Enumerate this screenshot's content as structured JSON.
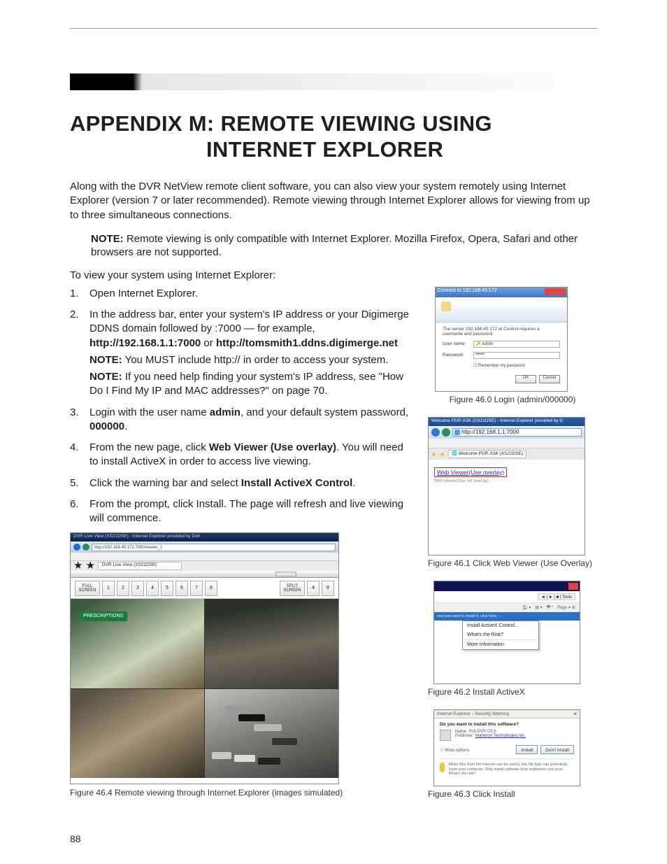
{
  "heading": {
    "line1": "APPENDIX M: REMOTE VIEWING USING",
    "line2": "INTERNET EXPLORER"
  },
  "intro": "Along with the DVR NetView remote client software, you can also view your system remotely using Internet Explorer (version 7 or later recommended). Remote viewing through Internet Explorer allows for viewing from up to three simultaneous connections.",
  "note1_label": "NOTE:",
  "note1_text": " Remote viewing is only compatible with Internet Explorer. Mozilla Firefox, Opera, Safari and other browsers are not supported.",
  "lead": "To view your system using Internet Explorer:",
  "steps": {
    "s1": "Open Internet Explorer.",
    "s2a": "In the address bar, enter your system's IP address or your Digimerge DDNS domain followed by :7000 — for example, ",
    "s2b": "http://192.168.1.1:7000",
    "s2c": " or ",
    "s2d": "http://tomsmith1.ddns.digimerge.net",
    "s2_note1_label": "NOTE:",
    "s2_note1_text": " You MUST include http:// in order to access your system.",
    "s2_note2_label": "NOTE:",
    "s2_note2_text": " If you need help finding your system's IP address, see \"How Do I Find My IP and MAC addresses?\" on page 70.",
    "s3a": "Login with the user name ",
    "s3b": "admin",
    "s3c": ", and your default system password, ",
    "s3d": "000000",
    "s3e": ".",
    "s4a": "From the new page, click ",
    "s4b": "Web Viewer (Use overlay)",
    "s4c": ". You will need to install ActiveX in order to access live viewing.",
    "s5a": "Click the warning bar and select ",
    "s5b": "Install ActiveX Control",
    "s5c": ".",
    "s6": "From the prompt, click Install. The page will refresh and live viewing will commence."
  },
  "fig460": {
    "title": "Connect to 192.168.45.172",
    "msg": "The server 192.168.45.172 at Control requires a username and password.",
    "user_lab": "User name:",
    "user_val": "admin",
    "pass_lab": "Password:",
    "pass_val": "••••••",
    "remember": "Remember my password",
    "ok": "OK",
    "cancel": "Cancel",
    "cap": "Figure 46.0 Login (admin/000000)"
  },
  "fig461": {
    "title": "Welcome PDR-X3K (XS21DSE) - Internet Explorer provided by D",
    "addr": "http://192.168.1.1:7000",
    "tab": "Welcome PDR-X3K (XS21DSE)",
    "link1": "Web Viewer(Use overlay)",
    "link2": "Web Viewer(Use not overlay)",
    "cap": "Figure 46.1 Click Web Viewer (Use Overlay)"
  },
  "fig462": {
    "tool_page": "Page",
    "warn": "orer just want to install it, click here...",
    "m1": "Install ActiveX Control...",
    "m2": "What's the Risk?",
    "m3": "More Information",
    "cap": "Figure 46.2 Install ActiveX"
  },
  "fig463": {
    "title": "Internet Explorer - Security Warning",
    "q": "Do you want to install this software?",
    "name": "Name: Pnb DVR OCX",
    "publisher_l": "Publisher: ",
    "publisher_v": "Hunteron Technologies Inc.",
    "more": "More options",
    "install": "Install",
    "dont": "Don't Install",
    "warn": "While files from the Internet can be useful, this file type can potentially harm your computer. Only install software from publishers you trust. What's the risk?",
    "cap": "Figure 46.3 Click Install"
  },
  "fig464": {
    "title": "DVR Live View (XS21DSE) - Internet Explorer provided by Dell",
    "addr": "http://192.168.45.172:7000/viewer_1",
    "tab": "DVR Live View (XS21DSE)",
    "full": "FULL SCREEN",
    "split": "SPLIT SCREEN",
    "n1": "1",
    "n2": "2",
    "n3": "3",
    "n4": "4",
    "n5": "5",
    "n6": "6",
    "n7": "7",
    "n8": "8",
    "n9": "4",
    "n10": "9",
    "cap": "Figure 46.4 Remote viewing through Internet Explorer (images simulated)"
  },
  "page_num": "88"
}
